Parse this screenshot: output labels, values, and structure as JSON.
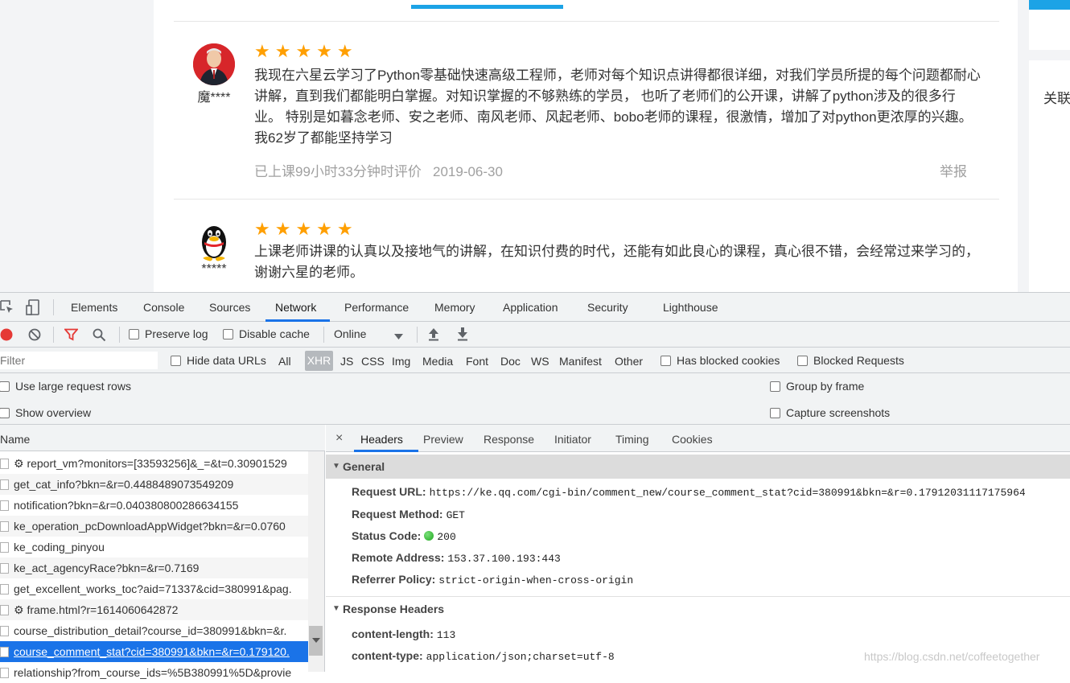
{
  "page": {
    "right_panel_label": "关联",
    "reviews": [
      {
        "name": "魔****",
        "stars": "★★★★★",
        "rating": 5,
        "text": "我现在六星云学习了Python零基础快速高级工程师，老师对每个知识点讲得都很详细，对我们学员所提的每个问题都耐心讲解，直到我们都能明白掌握。对知识掌握的不够熟练的学员， 也听了老师们的公开课，讲解了python涉及的很多行业。 特别是如暮念老师、安之老师、南风老师、风起老师、bobo老师的课程，很激情，增加了对python更浓厚的兴趣。我62岁了都能坚持学习",
        "meta": "已上课99小时33分钟时评价",
        "date": "2019-06-30",
        "report": "举报"
      },
      {
        "name": "*****",
        "stars": "★★★★★",
        "rating": 5,
        "text": "上课老师讲课的认真以及接地气的讲解，在知识付费的时代，还能有如此良心的课程，真心很不错，会经常过来学习的，谢谢六星的老师。"
      }
    ]
  },
  "devtools": {
    "tabs": [
      "Elements",
      "Console",
      "Sources",
      "Network",
      "Performance",
      "Memory",
      "Application",
      "Security",
      "Lighthouse"
    ],
    "active_tab": "Network",
    "toolbar": {
      "preserve_log": "Preserve log",
      "disable_cache": "Disable cache",
      "throttling": "Online"
    },
    "filter": {
      "placeholder": "Filter",
      "hide_data_urls": "Hide data URLs",
      "types": [
        "All",
        "XHR",
        "JS",
        "CSS",
        "Img",
        "Media",
        "Font",
        "Doc",
        "WS",
        "Manifest",
        "Other"
      ],
      "active_type": "XHR",
      "has_blocked_cookies": "Has blocked cookies",
      "blocked_requests": "Blocked Requests"
    },
    "settings": {
      "use_large_rows": "Use large request rows",
      "show_overview": "Show overview",
      "group_by_frame": "Group by frame",
      "capture_screenshots": "Capture screenshots"
    },
    "list": {
      "column_name": "Name",
      "rows": [
        "⚙ report_vm?monitors=[33593256]&_=&t=0.30901529",
        "get_cat_info?bkn=&r=0.4488489073549209",
        "notification?bkn=&r=0.040380800286634155",
        "ke_operation_pcDownloadAppWidget?bkn=&r=0.0760",
        "ke_coding_pinyou",
        "ke_act_agencyRace?bkn=&r=0.7169",
        "get_excellent_works_toc?aid=71337&cid=380991&pag.",
        "⚙ frame.html?r=1614060642872",
        "course_distribution_detail?course_id=380991&bkn=&r.",
        "course_comment_stat?cid=380991&bkn=&r=0.179120.",
        "relationship?from_course_ids=%5B380991%5D&provie"
      ],
      "selected_index": 9
    },
    "details": {
      "close": "×",
      "tabs": [
        "Headers",
        "Preview",
        "Response",
        "Initiator",
        "Timing",
        "Cookies"
      ],
      "active_tab": "Headers",
      "general_title": "General",
      "general": [
        {
          "key": "Request URL:",
          "value": "https://ke.qq.com/cgi-bin/comment_new/course_comment_stat?cid=380991&bkn=&r=0.17912031117175964"
        },
        {
          "key": "Request Method:",
          "value": "GET"
        },
        {
          "key": "Status Code:",
          "value": "200"
        },
        {
          "key": "Remote Address:",
          "value": "153.37.100.193:443"
        },
        {
          "key": "Referrer Policy:",
          "value": "strict-origin-when-cross-origin"
        }
      ],
      "response_headers_title": "Response Headers",
      "response_headers": [
        {
          "key": "content-length:",
          "value": "113"
        },
        {
          "key": "content-type:",
          "value": "application/json;charset=utf-8"
        }
      ]
    }
  },
  "watermark": "https://blog.csdn.net/coffeetogether",
  "colors": {
    "accent": "#1a73e8",
    "star": "#ff9f00",
    "site_accent": "#1ca3e6",
    "status_ok": "#1ea61e",
    "record_red": "#e53935"
  }
}
